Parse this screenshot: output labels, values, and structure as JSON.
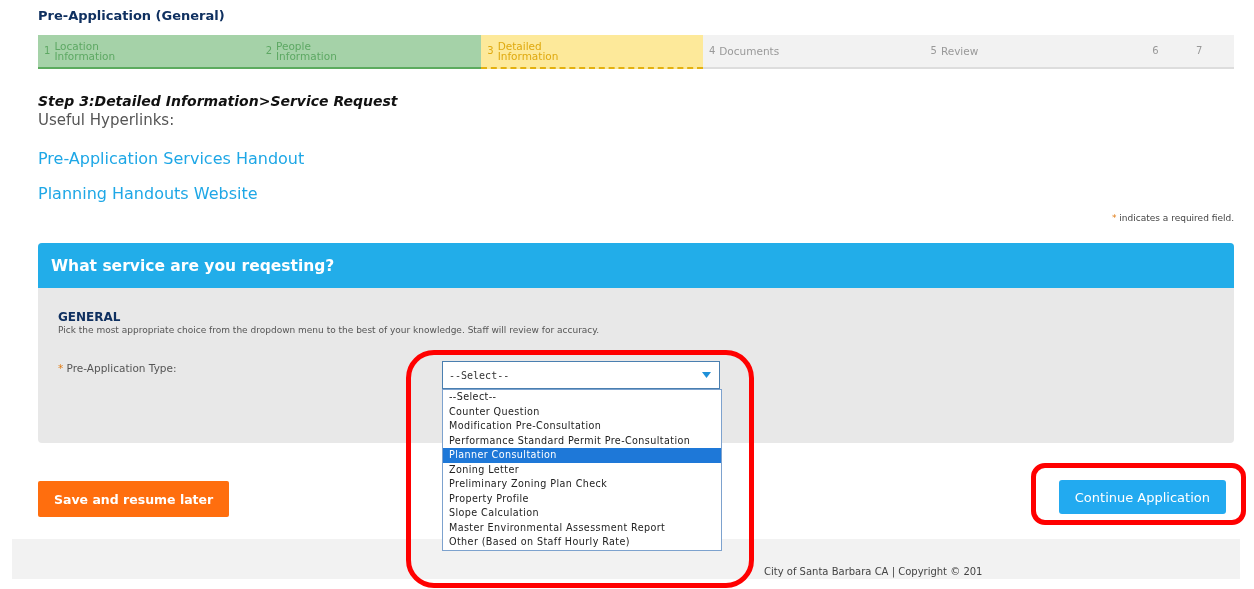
{
  "page_title": "Pre-Application (General)",
  "steps": [
    {
      "number": "1",
      "label": "Location Information",
      "completed": true,
      "selected": false
    },
    {
      "number": "2",
      "label": "People Information",
      "completed": true,
      "selected": false
    },
    {
      "number": "3",
      "label": "Detailed Information",
      "completed": false,
      "selected": true
    },
    {
      "number": "4",
      "label": "Documents",
      "completed": false,
      "selected": false
    },
    {
      "number": "5",
      "label": "Review",
      "completed": false,
      "selected": false
    },
    {
      "number": "6",
      "completed": false,
      "selected": false
    },
    {
      "number": "7",
      "completed": false,
      "selected": false
    }
  ],
  "step_heading": "Step 3:Detailed Information>Service Request",
  "links_heading": "Useful Hyperlinks:",
  "links": [
    "Pre-Application Services Handout",
    "Planning Handouts Website"
  ],
  "required_note": {
    "mark": "*",
    "text": "indicates a required field."
  },
  "section": {
    "title": "What service are you reqesting?",
    "group_title": "GENERAL",
    "instructions": "Pick the most appropriate choice from the dropdown menu to the best of your knowledge. Staff will review for accuracy.",
    "field": {
      "required_mark": "*",
      "label": "Pre-Application Type:",
      "value": "--Select--",
      "expanded": true,
      "options": [
        {
          "label": "--Select--",
          "highlighted": false
        },
        {
          "label": "Counter Question",
          "highlighted": false
        },
        {
          "label": "Modification Pre-Consultation",
          "highlighted": false
        },
        {
          "label": "Performance Standard Permit Pre-Consultation",
          "highlighted": false
        },
        {
          "label": "Planner Consultation",
          "highlighted": true
        },
        {
          "label": "Zoning Letter",
          "highlighted": false
        },
        {
          "label": "Preliminary Zoning Plan Check",
          "highlighted": false
        },
        {
          "label": "Property Profile",
          "highlighted": false
        },
        {
          "label": "Slope Calculation",
          "highlighted": false
        },
        {
          "label": "Master Environmental Assessment Report",
          "highlighted": false
        },
        {
          "label": "Other (Based on Staff Hourly Rate)",
          "highlighted": false
        }
      ]
    }
  },
  "buttons": {
    "save": "Save and resume later",
    "continue": "Continue Application"
  },
  "footer": "City of Santa Barbara CA | Copyright © 201"
}
